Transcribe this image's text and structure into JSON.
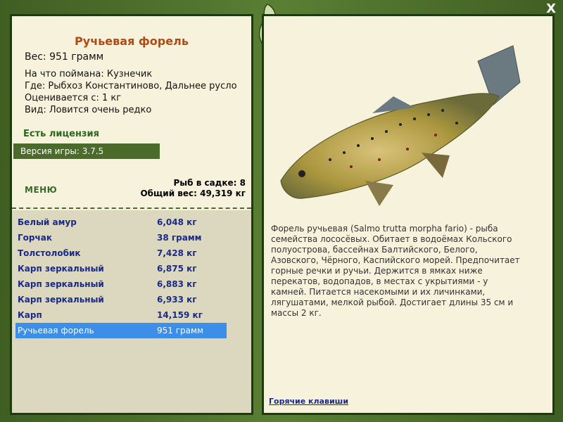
{
  "close_label": "X",
  "fish": {
    "title": "Ручьевая форель",
    "weight": "Вес: 951 грамм",
    "caught_on": "На что поймана: Кузнечик",
    "location": "Где: Рыбхоз Константиново, Дальнее русло",
    "rated_from": "Оценивается с: 1 кг",
    "rarity": "Вид: Ловится очень редко"
  },
  "license": "Есть лицензия",
  "version": "Версия игры: 3.7.5",
  "menu_label": "МЕНЮ",
  "keepnet": {
    "count": "Рыб в садке: 8",
    "total": "Общий вес: 49,319 кг"
  },
  "catch_list": [
    {
      "name": "Белый амур",
      "weight": "6,048 кг",
      "selected": false
    },
    {
      "name": "Горчак",
      "weight": "38 грамм",
      "selected": false
    },
    {
      "name": "Толстолобик",
      "weight": "7,428 кг",
      "selected": false
    },
    {
      "name": "Карп зеркальный",
      "weight": "6,875 кг",
      "selected": false
    },
    {
      "name": "Карп зеркальный",
      "weight": "6,883 кг",
      "selected": false
    },
    {
      "name": "Карп зеркальный",
      "weight": "6,933 кг",
      "selected": false
    },
    {
      "name": "Карп",
      "weight": "14,159 кг",
      "selected": false
    },
    {
      "name": "Ручьевая форель",
      "weight": "951 грамм",
      "selected": true
    }
  ],
  "description": "Форель ручьевая (Salmo trutta morpha fario) - рыба семейства лососёвых. Обитает в водоёмах Кольского полуострова, бассейнах Балтийского, Белого, Азовского, Чёрного, Каспийского морей. Предпочитает горные речки и ручьи. Держится в ямках ниже перекатов, водопадов, в местах с укрытиями - у камней. Питается насекомыми и их личинками, лягушатами, мелкой рыбой. Достигает длины 35 см и массы 2 кг.",
  "hotkeys_label": "Горячие клавиши"
}
